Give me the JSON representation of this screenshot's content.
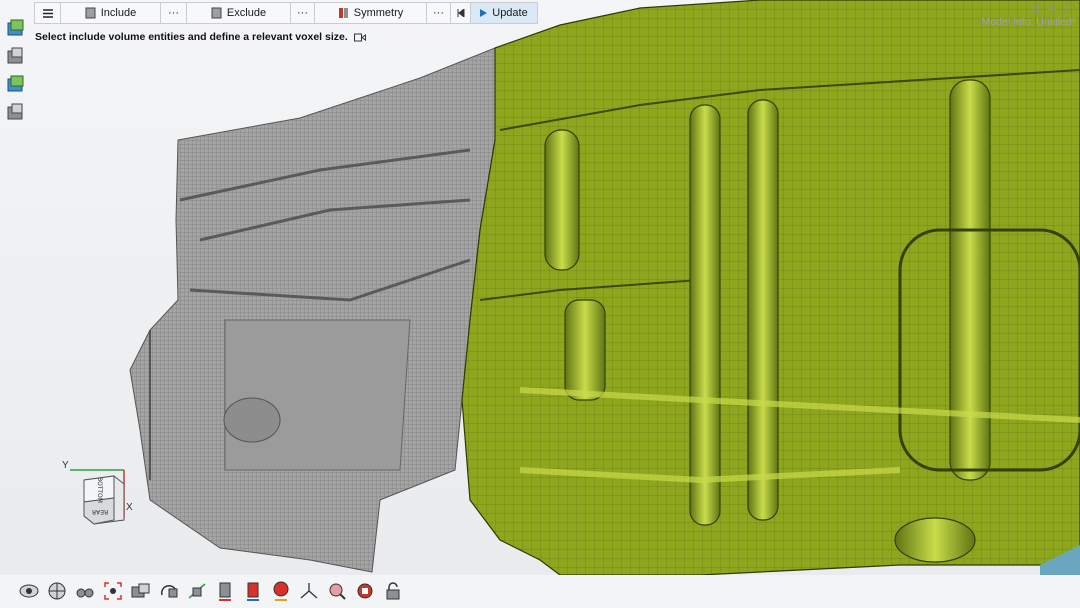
{
  "toolbar": {
    "menu_icon": "menu-icon",
    "include_label": "Include",
    "include_more": "···",
    "exclude_label": "Exclude",
    "exclude_more": "···",
    "symmetry_label": "Symmetry",
    "symmetry_more": "···",
    "reset_icon": "step-back-icon",
    "update_label": "Update"
  },
  "message": "Select include volume entities and define a relevant voxel size.",
  "model_info": "Model Info: Untitled*",
  "triad": {
    "y_label": "Y",
    "x_label": "X",
    "face_top": "BOTTOM",
    "face_front": "REAR"
  },
  "colors": {
    "mesh_green": "#8ea61e",
    "voxel_gray": "#a3a3a3",
    "accent_blue": "#1e6fc0"
  },
  "left_icons": [
    "part-browser-icon",
    "display-icon",
    "part-browser-icon",
    "display-icon"
  ],
  "bottom_icons": [
    "view-eye-icon",
    "globe-icon",
    "binoculars-icon",
    "fit-view-icon",
    "camera-icon",
    "rotate-icon",
    "section-icon",
    "shaded-icon",
    "mesh-display-icon",
    "color-mode-icon",
    "axis-icon",
    "zoom-icon",
    "snapshot-icon",
    "lock-icon"
  ]
}
